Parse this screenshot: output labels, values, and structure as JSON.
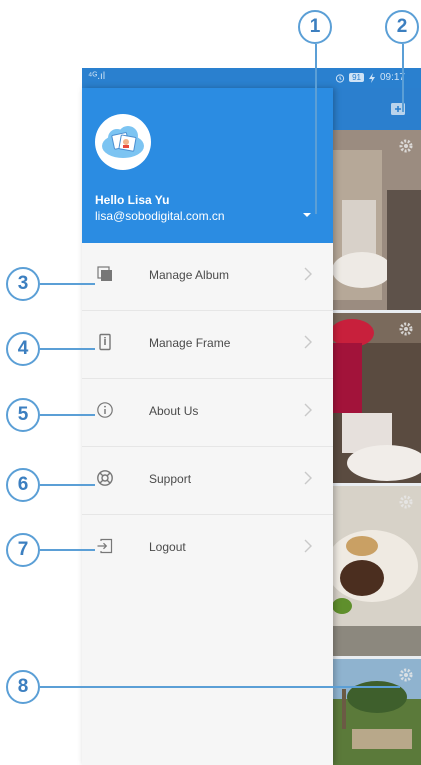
{
  "status_bar": {
    "signal_text": "⁴ᴳ.ıl",
    "battery_text": "91",
    "time": "09:17"
  },
  "drawer": {
    "user_name": "Hello Lisa Yu",
    "user_email": "lisa@sobodigital.com.cn",
    "menu_items": [
      {
        "label": "Manage Album",
        "icon": "album-stack-icon"
      },
      {
        "label": "Manage Frame",
        "icon": "frame-device-icon"
      },
      {
        "label": "About Us",
        "icon": "info-circle-icon"
      },
      {
        "label": "Support",
        "icon": "lifebuoy-icon"
      },
      {
        "label": "Logout",
        "icon": "logout-icon"
      }
    ]
  },
  "callouts": [
    "1",
    "2",
    "3",
    "4",
    "5",
    "6",
    "7",
    "8"
  ],
  "colors": {
    "header_blue": "#2b8ce2",
    "callout_blue": "#5b9fd6",
    "drawer_bg": "#f6f6f6"
  }
}
